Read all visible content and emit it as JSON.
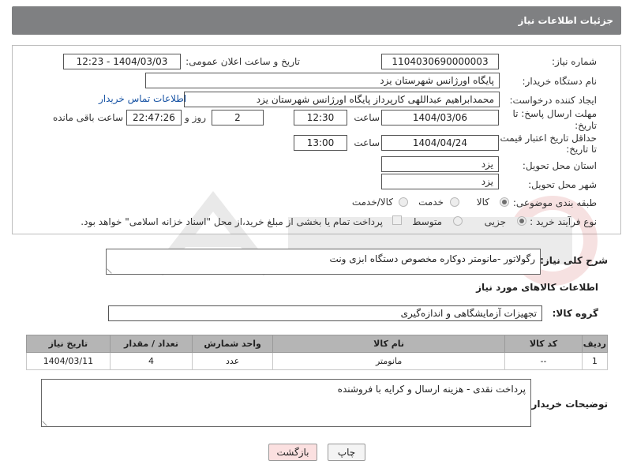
{
  "header": {
    "title": "جزئیات اطلاعات نیاز"
  },
  "form": {
    "need_number_label": "شماره نیاز:",
    "need_number": "1104030690000003",
    "announce_label": "تاریخ و ساعت اعلان عمومی:",
    "announce_value": "1404/03/03 - 12:23",
    "buyer_org_label": "نام دستگاه خریدار:",
    "buyer_org": "پایگاه اورژانس شهرستان یزد",
    "creator_label": "ایجاد کننده درخواست:",
    "creator": "محمدابراهیم عبداللهی کارپرداز پایگاه اورژانس شهرستان یزد",
    "contact_link": "اطلاعات تماس خریدار",
    "deadline_label_1": "مهلت ارسال پاسخ: تا",
    "deadline_label_2": "تاریخ:",
    "deadline_date": "1404/03/06",
    "time_label": "ساعت",
    "deadline_time": "12:30",
    "days_value": "2",
    "days_label": "روز و",
    "remaining_time": "22:47:26",
    "remaining_label": "ساعت باقی مانده",
    "validity_label_1": "حداقل تاریخ اعتبار قیمت:",
    "validity_label_2": "تا تاریخ:",
    "validity_date": "1404/04/24",
    "validity_time_label": "ساعت",
    "validity_time": "13:00",
    "province_label": "استان محل تحویل:",
    "province": "یزد",
    "city_label": "شهر محل تحویل:",
    "city": "یزد",
    "category_label": "طبقه بندی موضوعی:",
    "category_options": [
      "کالا",
      "خدمت",
      "کالا/خدمت"
    ],
    "category_selected": "کالا",
    "purchase_label": "نوع فرآیند خرید :",
    "purchase_options": [
      "جزیی",
      "متوسط"
    ],
    "purchase_selected": "جزیی",
    "payment_note": "پرداخت تمام یا بخشی از مبلغ خرید،از محل \"اسناد خزانه اسلامی\" خواهد بود."
  },
  "description": {
    "label": "شرح کلی نیاز:",
    "value": "رگولاتور -مانومتر دوکاره مخصوص دستگاه ابزی ونت"
  },
  "goods_section": {
    "title": "اطلاعات کالاهای مورد نیاز"
  },
  "goods_group": {
    "label": "گروه کالا:",
    "value": "تجهیزات آزمایشگاهی و اندازه‌گیری"
  },
  "table": {
    "headers": [
      "ردیف",
      "کد کالا",
      "نام کالا",
      "واحد شمارش",
      "تعداد / مقدار",
      "تاریخ نیاز"
    ],
    "rows": [
      [
        "1",
        "--",
        "مانومتر",
        "عدد",
        "4",
        "1404/03/11"
      ]
    ]
  },
  "buyer_notes": {
    "label": "توضیحات خریدار:",
    "value": "پرداخت نقدی - هزینه ارسال و کرایه با فروشنده"
  },
  "buttons": {
    "print": "چاپ",
    "back": "بازگشت"
  },
  "colors": {
    "header_bg": "#7f8082",
    "link": "#1a55a5",
    "table_header": "#b5b5b5",
    "back_button_bg": "#fbe0e0"
  }
}
